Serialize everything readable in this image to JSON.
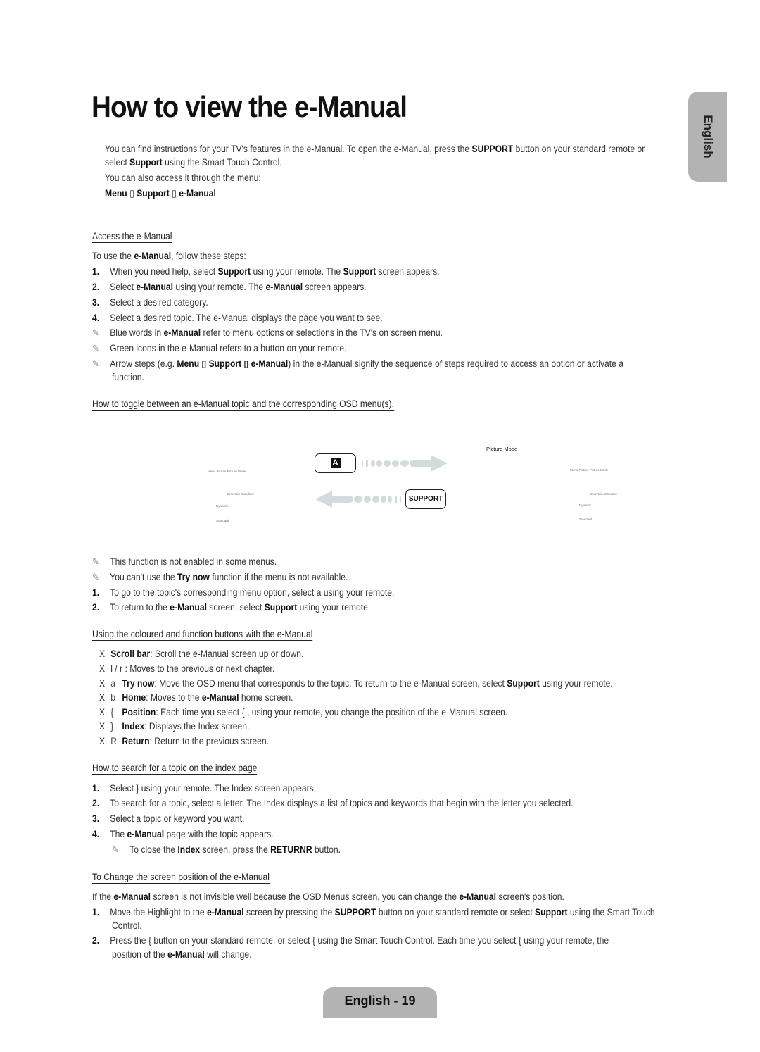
{
  "page": {
    "title": "How to view the e-Manual",
    "side_tab": "English",
    "footer": "English - 19"
  },
  "intro": {
    "line1_a": "You can find instructions for your TV's features in the e-Manual. To open the e-Manual, press the ",
    "line1_b": "SUPPORT",
    "line1_c": " button on your standard remote or",
    "line2_a": "select ",
    "line2_b": "Support",
    "line2_c": " using the Smart Touch Control.",
    "line3": "You can also access it through the menu:",
    "path": [
      "Menu",
      "Support",
      "e-Manual"
    ],
    "path_sep": "▯"
  },
  "access": {
    "heading": "Access the e-Manual",
    "lead_a": "To use the ",
    "lead_b": "e-Manual",
    "lead_c": ", follow these steps:",
    "steps": [
      {
        "num": "1.",
        "a": "When you need help, select ",
        "b": "Support",
        "c": " using your remote. The ",
        "d": "Support",
        "e": " screen appears."
      },
      {
        "num": "2.",
        "a": "Select ",
        "b": "e-Manual",
        "c": " using your remote. The ",
        "d": "e-Manual",
        "e": " screen appears."
      },
      {
        "num": "3.",
        "a": "Select a desired category."
      },
      {
        "num": "4.",
        "a": "Select a desired topic. The e-Manual displays the page you want to see."
      }
    ],
    "notes": [
      {
        "a": "Blue words in ",
        "b": "e-Manual",
        "c": " refer to menu options or selections in the TV's on screen menu."
      },
      {
        "a": "Green icons in the e-Manual refers to a button on your remote."
      },
      {
        "a": "Arrow steps (e.g. ",
        "b": "Menu ▯  Support ▯  e-Manual",
        "c": ") in the e-Manual signify the sequence of steps required to access an option or activate a",
        "d": "function."
      }
    ]
  },
  "toggle": {
    "heading": "How to toggle between an e-Manual topic and the corresponding OSD menu(s).",
    "diagram": {
      "a_button": "A",
      "support_button": "SUPPORT",
      "right_title": "Picture Mode",
      "left_menu": {
        "breadcrumb": "Menu    Picture    Picture Mode",
        "row1": "Entertain      Standard",
        "row2": "Dynamic",
        "row3": "Standard"
      },
      "right_menu": {
        "breadcrumb": "Menu    Picture    Picture Mode",
        "row1": "Entertain      Standard",
        "row2": "Dynamic",
        "row3": "Standard"
      }
    },
    "notes": [
      {
        "a": "This function is not enabled in some menus."
      },
      {
        "a": "You can't use the ",
        "b": "Try now",
        "c": " function if the menu is not available."
      }
    ],
    "steps": [
      {
        "num": "1.",
        "a": "To go to the topic's corresponding menu option, select ",
        "b": "a",
        "c": "   using your remote."
      },
      {
        "num": "2.",
        "a": "To return to the ",
        "b": "e-Manual",
        "c": " screen, select ",
        "d": "Support",
        "e": " using your remote."
      }
    ]
  },
  "buttons": {
    "heading": "Using the coloured and function buttons with the e-Manual",
    "bullet": "X",
    "items": [
      {
        "sym": "",
        "b": "Scroll bar",
        "c": ": Scroll the e-Manual screen up or down."
      },
      {
        "sym": "l   / r",
        "b": "",
        "c": " : Moves to the previous or next chapter."
      },
      {
        "sym": "a",
        "b": "Try now",
        "c": ": Move the OSD menu that corresponds to the topic. To return to the e-Manual screen, select ",
        "d": "Support",
        "e": " using your remote."
      },
      {
        "sym": "b",
        "b": "Home",
        "c": ": Moves to the ",
        "d": "e-Manual",
        "e": " home screen."
      },
      {
        "sym": "{",
        "b": "Position",
        "c": ": Each time you select {   , using your remote, you change the position of the e-Manual screen."
      },
      {
        "sym": "}",
        "b": "Index",
        "c": ": Displays the Index screen."
      },
      {
        "sym": "R",
        "b": "Return",
        "c": ": Return to the previous screen."
      }
    ]
  },
  "search": {
    "heading": "How to search for a topic on the index page",
    "steps": [
      {
        "num": "1.",
        "a": "Select }    using your remote. The Index screen appears."
      },
      {
        "num": "2.",
        "a": "To search for a topic, select a letter. The Index displays a list of topics and keywords that begin with the letter you selected."
      },
      {
        "num": "3.",
        "a": "Select a topic or keyword you want."
      },
      {
        "num": "4.",
        "a": "The ",
        "b": "e-Manual",
        "c": " page with the topic appears."
      }
    ],
    "note": {
      "a": "To close the ",
      "b": "Index",
      "c": " screen, press the ",
      "d": "RETURNR",
      "e": "  button."
    }
  },
  "position": {
    "heading": "To Change the screen position of the e-Manual",
    "lead": {
      "a": "If the ",
      "b": "e-Manual",
      "c": " screen is not invisible well because the OSD Menus screen, you can change the ",
      "d": "e-Manual",
      "e": " screen's position."
    },
    "steps": [
      {
        "num": "1.",
        "a": "Move the Highlight to the ",
        "b": "e-Manual",
        "c": " screen by pressing the ",
        "d": "SUPPORT",
        "e": " button on your standard remote or select ",
        "f": "Support",
        "g": " using the Smart Touch",
        "h": "Control."
      },
      {
        "num": "2.",
        "a": "Press the {    button on your standard remote, or select {    using the Smart Touch Control. Each time you select {    using your remote, the",
        "b": "position of the ",
        "c": "e-Manual",
        "d": " will change."
      }
    ]
  }
}
